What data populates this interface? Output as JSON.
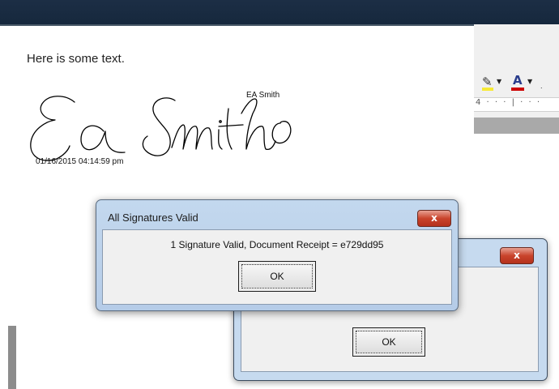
{
  "document": {
    "body_text": "Here is some text.",
    "signer_name": "EA Smith",
    "signature_timestamp": "01/16/2015  04:14:59 pm"
  },
  "toolbar": {
    "highlight_icon": "highlighter-icon",
    "highlight_color": "#f7ea35",
    "font_color_icon": "font-color-icon",
    "font_color": "#cc0000",
    "ruler_marks": "4 · · · | · · ·"
  },
  "dialog_front": {
    "title": "All Signatures Valid",
    "message": "1 Signature Valid, Document Receipt = e729dd95",
    "ok_label": "OK",
    "close_label": "x"
  },
  "dialog_back": {
    "ok_label": "OK",
    "close_label": "x"
  }
}
